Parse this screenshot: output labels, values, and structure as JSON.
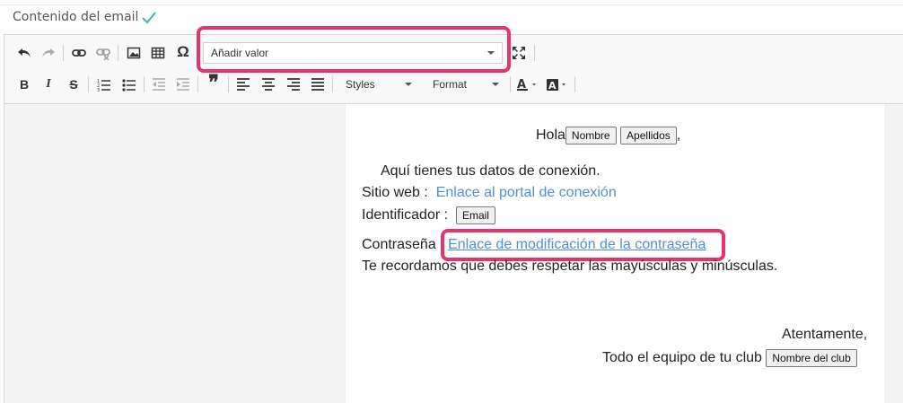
{
  "header": {
    "title": "Contenido del email"
  },
  "toolbar": {
    "insert_value": {
      "selected": "Añadir valor"
    },
    "styles_label": "Styles",
    "format_label": "Format",
    "special_char": "Ω",
    "bold": "B",
    "italic": "I",
    "strike": "S",
    "blockquote": "❞"
  },
  "email": {
    "greeting": "Hola",
    "field_nombre": "Nombre",
    "field_apellidos": "Apellidos",
    "comma": ",",
    "intro": "Aquí tienes tus datos de conexión.",
    "site_label": "Sitio web :",
    "site_link": "Enlace al portal de conexión",
    "id_label": "Identificador :",
    "field_email": "Email",
    "password_label": "Contraseña :",
    "password_link": "Enlace de modificación de la contraseña",
    "reminder": "Te recordamos que debes respetar las mayúsculas y minúsculas.",
    "closing": "Atentamente,",
    "signature": "Todo el equipo de tu club",
    "field_club": "Nombre del club"
  },
  "colors": {
    "highlight": "#e8336a",
    "link": "#4f8fd6",
    "check": "#3bb5a5"
  }
}
